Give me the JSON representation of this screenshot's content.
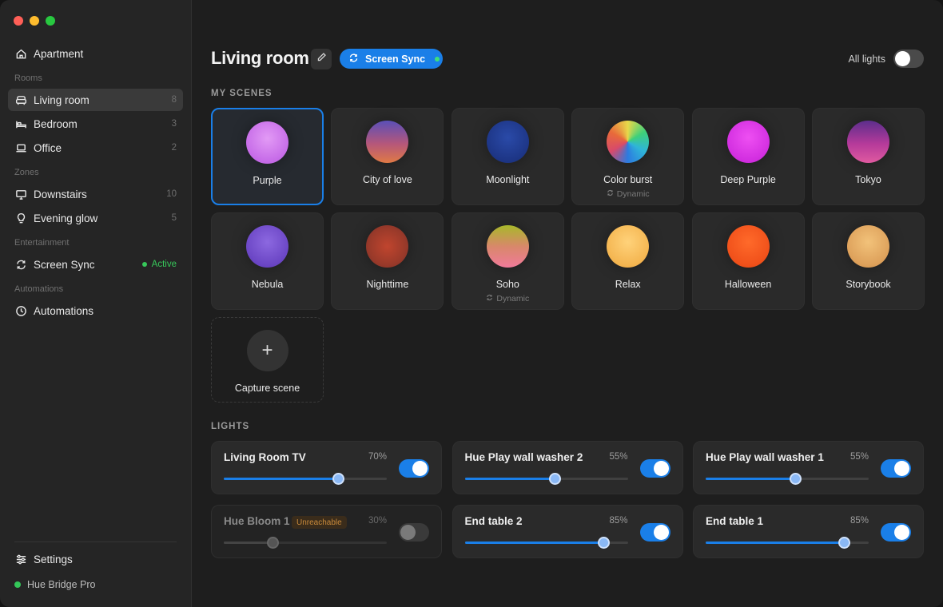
{
  "sidebar": {
    "home": {
      "label": "Apartment",
      "icon": "home-icon"
    },
    "rooms_label": "Rooms",
    "rooms": [
      {
        "label": "Living room",
        "count": "8",
        "icon": "sofa-icon",
        "selected": true
      },
      {
        "label": "Bedroom",
        "count": "3",
        "icon": "bed-icon"
      },
      {
        "label": "Office",
        "count": "2",
        "icon": "laptop-icon"
      }
    ],
    "zones_label": "Zones",
    "zones": [
      {
        "label": "Downstairs",
        "count": "10",
        "icon": "monitor-icon"
      },
      {
        "label": "Evening glow",
        "count": "5",
        "icon": "bulb-icon"
      }
    ],
    "entertainment_label": "Entertainment",
    "entertainment": [
      {
        "label": "Screen Sync",
        "status": "Active",
        "icon": "sync-icon"
      }
    ],
    "automations_label": "Automations",
    "automations": [
      {
        "label": "Automations",
        "icon": "clock-icon"
      }
    ],
    "settings": {
      "label": "Settings",
      "icon": "sliders-icon"
    },
    "bridge": {
      "label": "Hue Bridge Pro",
      "status_color": "#34c759"
    }
  },
  "header": {
    "title": "Living room",
    "sync_label": "Screen Sync",
    "all_lights_label": "All lights",
    "all_lights_on": false
  },
  "scenes": {
    "heading": "MY SCENES",
    "items": [
      {
        "name": "Purple",
        "selected": true,
        "orb": "radial-gradient(circle at 50% 40%, #e29af5, #c66be8 70%, #b45ad8)"
      },
      {
        "name": "City of love",
        "orb": "linear-gradient(180deg, #5a4fb8 0%, #b5577a 55%, #e07a45 100%)"
      },
      {
        "name": "Moonlight",
        "orb": "radial-gradient(circle at 50% 40%, #2a4aa8, #1d3585 70%, #182c70)"
      },
      {
        "name": "Color burst",
        "sub": "Dynamic",
        "orb": "conic-gradient(from 0deg, #e8d84a, #3ed07a, #2fb5d8, #2c7be0, #d84a6a, #e86a3a, #e8d84a)"
      },
      {
        "name": "Deep Purple",
        "orb": "radial-gradient(circle at 50% 40%, #ee4ff2, #d22ee0 70%, #c020d0)"
      },
      {
        "name": "Tokyo",
        "orb": "linear-gradient(180deg, #5c2e8c 0%, #b53a9a 55%, #e05aa0 100%)"
      },
      {
        "name": "Nebula",
        "orb": "radial-gradient(circle at 50% 40%, #8c68e0, #6a45c4 70%, #5a38b0)"
      },
      {
        "name": "Nighttime",
        "orb": "radial-gradient(circle at 50% 50%, #c0452e, #9a3a2a 60%, #7a2e25)"
      },
      {
        "name": "Soho",
        "sub": "Dynamic",
        "orb": "linear-gradient(180deg, #a8b82a 0%, #d8886a 50%, #f07a9a 100%)"
      },
      {
        "name": "Relax",
        "orb": "radial-gradient(circle at 50% 40%, #ffd27a, #f4b550 70%, #eaa040)"
      },
      {
        "name": "Halloween",
        "orb": "radial-gradient(circle at 50% 40%, #ff6a2a, #f0501a 70%, #d8400e)"
      },
      {
        "name": "Storybook",
        "orb": "radial-gradient(circle at 50% 40%, #f2c27a, #dda05a 70%, #c88a48)"
      }
    ],
    "capture_label": "Capture scene"
  },
  "lights": {
    "heading": "LIGHTS",
    "unreachable_label": "Unreachable",
    "items": [
      {
        "name": "Living Room TV",
        "brightness": 70,
        "pct": "70%",
        "on": true
      },
      {
        "name": "Hue Play wall washer 2",
        "brightness": 55,
        "pct": "55%",
        "on": true
      },
      {
        "name": "Hue Play wall washer 1",
        "brightness": 55,
        "pct": "55%",
        "on": true
      },
      {
        "name": "Hue Bloom 1",
        "brightness": 30,
        "pct": "30%",
        "on": false,
        "unreachable": true
      },
      {
        "name": "End table 2",
        "brightness": 85,
        "pct": "85%",
        "on": true
      },
      {
        "name": "End table 1",
        "brightness": 85,
        "pct": "85%",
        "on": true
      }
    ]
  },
  "colors": {
    "accent": "#1a7fe8",
    "active": "#37c75a",
    "warning": "#c98a3a"
  }
}
